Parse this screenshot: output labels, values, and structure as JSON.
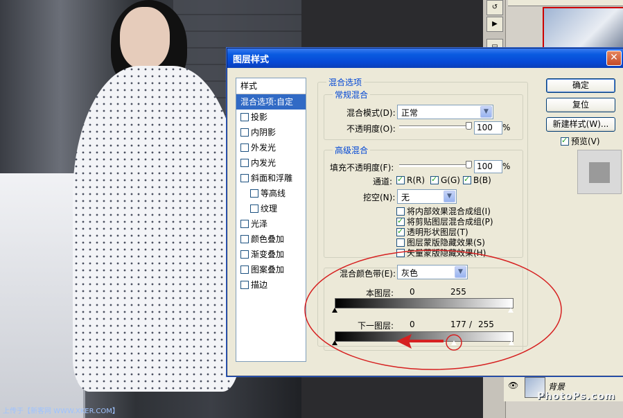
{
  "credit": "上传于【新客网 WWW.XKER.COM】",
  "watermark": "PhotoPs.com",
  "layer_panel": {
    "layer_name": "背景"
  },
  "dialog": {
    "title": "图层样式",
    "close_glyph": "✕",
    "styles_header": "样式",
    "styles": [
      {
        "label": "混合选项:自定",
        "checkbox": false,
        "selected": true,
        "indent": false
      },
      {
        "label": "投影",
        "checkbox": true,
        "checked": false,
        "indent": false
      },
      {
        "label": "内阴影",
        "checkbox": true,
        "checked": false,
        "indent": false
      },
      {
        "label": "外发光",
        "checkbox": true,
        "checked": false,
        "indent": false
      },
      {
        "label": "内发光",
        "checkbox": true,
        "checked": false,
        "indent": false
      },
      {
        "label": "斜面和浮雕",
        "checkbox": true,
        "checked": false,
        "indent": false
      },
      {
        "label": "等高线",
        "checkbox": true,
        "checked": false,
        "indent": true
      },
      {
        "label": "纹理",
        "checkbox": true,
        "checked": false,
        "indent": true
      },
      {
        "label": "光泽",
        "checkbox": true,
        "checked": false,
        "indent": false
      },
      {
        "label": "颜色叠加",
        "checkbox": true,
        "checked": false,
        "indent": false
      },
      {
        "label": "渐变叠加",
        "checkbox": true,
        "checked": false,
        "indent": false
      },
      {
        "label": "图案叠加",
        "checkbox": true,
        "checked": false,
        "indent": false
      },
      {
        "label": "描边",
        "checkbox": true,
        "checked": false,
        "indent": false
      }
    ],
    "blend_options_title": "混合选项",
    "general": {
      "title": "常规混合",
      "mode_label": "混合模式(D):",
      "mode_value": "正常",
      "opacity_label": "不透明度(O):",
      "opacity_value": "100",
      "opacity_unit": "%",
      "opacity_level": 1.0
    },
    "advanced": {
      "title": "高级混合",
      "fill_label": "填充不透明度(F):",
      "fill_value": "100",
      "fill_unit": "%",
      "fill_level": 1.0,
      "channels_label": "通道:",
      "ch_r": "R(R)",
      "ch_g": "G(G)",
      "ch_b": "B(B)",
      "knockout_label": "挖空(N):",
      "knockout_value": "无",
      "options": [
        {
          "label": "将内部效果混合成组(I)",
          "checked": false
        },
        {
          "label": "将剪贴图层混合成组(P)",
          "checked": true
        },
        {
          "label": "透明形状图层(T)",
          "checked": true
        },
        {
          "label": "图层蒙版隐藏效果(S)",
          "checked": false
        },
        {
          "label": "矢量蒙版隐藏效果(H)",
          "checked": false
        }
      ]
    },
    "blend_if": {
      "label": "混合颜色带(E):",
      "value": "灰色",
      "this_layer_label": "本图层:",
      "this_low": "0",
      "this_high": "255",
      "under_layer_label": "下一图层:",
      "under_low": "0",
      "under_split": "177",
      "under_sep": "/",
      "under_high": "255"
    },
    "buttons": {
      "ok": "确定",
      "reset": "复位",
      "new_style": "新建样式(W)..."
    },
    "preview_label": "预览(V)"
  }
}
